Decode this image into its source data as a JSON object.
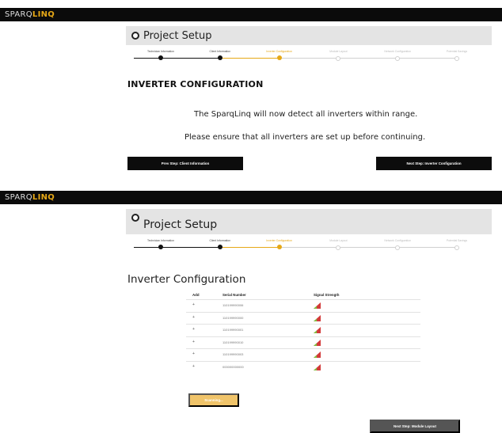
{
  "app": {
    "logo_left": "SPARQ",
    "logo_right": "LINQ"
  },
  "colors": {
    "accent": "#e6a817",
    "topbar": "#0b0b0b",
    "header_panel": "#e4e4e4",
    "signal_green": "#7fbf3f",
    "signal_red": "#d33a3a"
  },
  "steps": [
    {
      "label": "Technician Information",
      "state": "done"
    },
    {
      "label": "Client Information",
      "state": "done"
    },
    {
      "label": "Inverter Configuration",
      "state": "active"
    },
    {
      "label": "Module Layout",
      "state": "future"
    },
    {
      "label": "Network Configuration",
      "state": "future"
    },
    {
      "label": "Potential Savings",
      "state": "future"
    }
  ],
  "screen1": {
    "header_title": "Project Setup",
    "section_title": "INVERTER CONFIGURATION",
    "message_line1": "The SparqLinq will now detect all inverters within range.",
    "message_line2": "Please ensure that all inverters are set up before continuing.",
    "prev_button": "Prev Step: Client Information",
    "next_button": "Next Step: Inverter Configuration"
  },
  "screen2": {
    "header_title": "Project Setup",
    "section_title": "Inverter Configuration",
    "table": {
      "columns": [
        "Add",
        "Serial Number",
        "Signal Strength"
      ],
      "rows": [
        {
          "add": "+",
          "serial": "110199990006"
        },
        {
          "add": "+",
          "serial": "110199990000"
        },
        {
          "add": "+",
          "serial": "110199990001"
        },
        {
          "add": "+",
          "serial": "110199990010"
        },
        {
          "add": "+",
          "serial": "110199990003"
        },
        {
          "add": "+",
          "serial": "000000000000"
        }
      ]
    },
    "scanning_button": "Scanning...",
    "next_button": "Next Step: Module Layout"
  }
}
